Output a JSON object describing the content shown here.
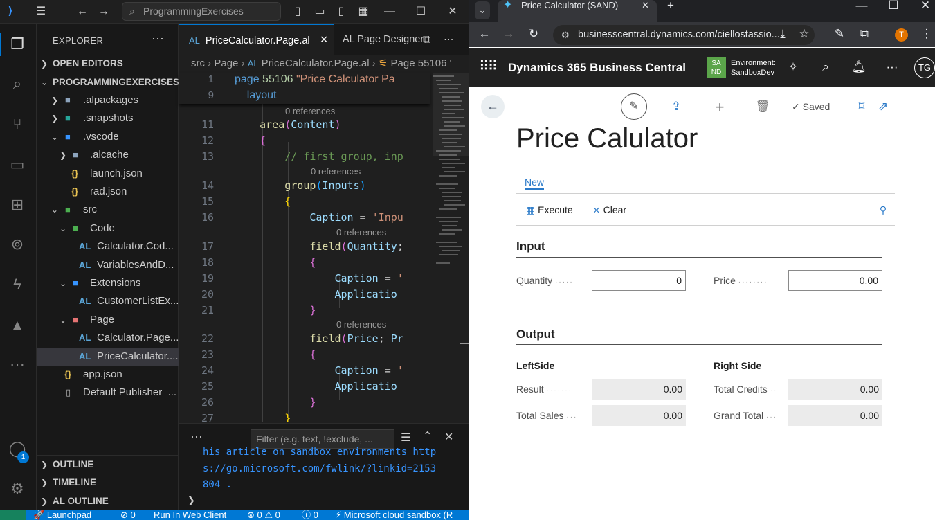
{
  "vscode": {
    "search_placeholder": "ProgrammingExercises",
    "explorer_title": "EXPLORER",
    "sections": {
      "open_editors": "OPEN EDITORS",
      "workspace": "PROGRAMMINGEXERCISES",
      "outline": "OUTLINE",
      "timeline": "TIMELINE",
      "al_outline": "AL OUTLINE"
    },
    "tree": [
      {
        "label": ".alpackages"
      },
      {
        "label": ".snapshots"
      },
      {
        "label": ".vscode"
      },
      {
        "label": ".alcache"
      },
      {
        "label": "launch.json"
      },
      {
        "label": "rad.json"
      },
      {
        "label": "src"
      },
      {
        "label": "Code"
      },
      {
        "label": "Calculator.Cod..."
      },
      {
        "label": "VariablesAndD..."
      },
      {
        "label": "Extensions"
      },
      {
        "label": "CustomerListEx..."
      },
      {
        "label": "Page"
      },
      {
        "label": "Calculator.Page..."
      },
      {
        "label": "PriceCalculator...."
      },
      {
        "label": "app.json"
      },
      {
        "label": "Default Publisher_..."
      }
    ],
    "tree_icon_al": "AL",
    "tree_icon_json": "{}",
    "badge_count": "1",
    "tabs": {
      "active": "PriceCalculator.Page.al",
      "inactive": "AL Page Designer",
      "al_tag": "AL"
    },
    "breadcrumb": {
      "p1": "src",
      "p2": "Page",
      "p3": "PriceCalculator.Page.al",
      "p4": "Page 55106 '"
    },
    "references": "0 references",
    "line_numbers": [
      "1",
      "9",
      "11",
      "12",
      "13",
      "14",
      "15",
      "16",
      "17",
      "18",
      "19",
      "20",
      "21",
      "22",
      "23",
      "24",
      "25",
      "26",
      "27"
    ],
    "filter_placeholder": "Filter (e.g. text, !exclude, ...",
    "output_lines": [
      "his article on sandbox environments http",
      "s://go.microsoft.com/fwlink/?linkid=2153",
      "804 ."
    ],
    "status": {
      "launchpad": "Launchpad",
      "ports": "0",
      "run": "Run In Web Client",
      "errors": "0",
      "warnings": "0",
      "info": "0",
      "sandbox": "Microsoft cloud sandbox (R"
    }
  },
  "browser": {
    "tab_title": "Price Calculator (SAND)",
    "url": "businesscentral.dynamics.com/ciellostassio...",
    "profile_initial": "T",
    "bc": {
      "app_name": "Dynamics 365 Business Central",
      "env_badge_line1": "SA",
      "env_badge_line2": "ND",
      "env_label": "Environment:",
      "env_name": "SandboxDev",
      "user_initials": "TG",
      "saved_label": "Saved",
      "page_title": "Price Calulator",
      "nav_tab": "New",
      "actions": {
        "execute": "Execute",
        "clear": "Clear"
      },
      "input_group": {
        "title": "Input",
        "quantity_label": "Quantity",
        "quantity_value": "0",
        "price_label": "Price",
        "price_value": "0.00"
      },
      "output_group": {
        "title": "Output",
        "left_title": "LeftSide",
        "right_title": "Right Side",
        "result_label": "Result",
        "result_value": "0.00",
        "total_sales_label": "Total Sales",
        "total_sales_value": "0.00",
        "total_credits_label": "Total Credits",
        "total_credits_value": "0.00",
        "grand_total_label": "Grand Total",
        "grand_total_value": "0.00"
      }
    }
  }
}
